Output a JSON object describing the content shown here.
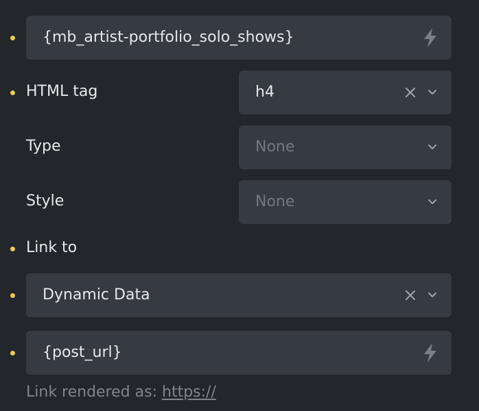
{
  "query_field": {
    "value": "{mb_artist-portfolio_solo_shows}",
    "icon": "bolt-icon"
  },
  "html_tag": {
    "label": "HTML tag",
    "value": "h4"
  },
  "type": {
    "label": "Type",
    "placeholder": "None"
  },
  "style": {
    "label": "Style",
    "placeholder": "None"
  },
  "link_to": {
    "label": "Link to",
    "select_value": "Dynamic Data"
  },
  "link_field": {
    "value": "{post_url}",
    "icon": "bolt-icon"
  },
  "hint": {
    "prefix": "Link rendered as: ",
    "link": "https://"
  },
  "colors": {
    "background": "#23262b",
    "field": "#363a41",
    "indicator": "#f2c94c",
    "text": "#e6e8eb",
    "muted": "#737880"
  }
}
